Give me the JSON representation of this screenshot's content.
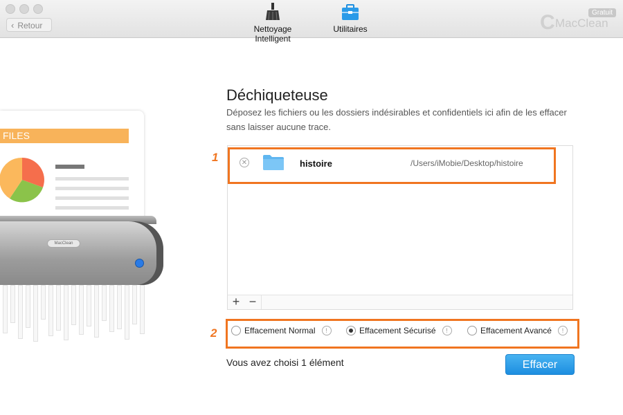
{
  "toolbar": {
    "back_label": "Retour",
    "tabs": [
      {
        "label": "Nettoyage Intelligent",
        "icon": "broom-icon"
      },
      {
        "label": "Utilitaires",
        "icon": "toolbox-icon"
      }
    ],
    "brand_name": "MacClean",
    "brand_badge": "Gratuit"
  },
  "illustration": {
    "banner_text": "FILES",
    "shredder_label": "MacClean"
  },
  "main": {
    "title": "Déchiqueteuse",
    "description": " Déposez les fichiers ou les dossiers indésirables et confidentiels ici afin de les effacer sans laisser aucune trace.",
    "files": [
      {
        "name": "histoire",
        "path": "/Users/iMobie/Desktop/histoire"
      }
    ],
    "add_symbol": "+",
    "remove_symbol": "−",
    "markers": [
      "1",
      "2"
    ],
    "options": [
      {
        "label": "Effacement Normal",
        "selected": false
      },
      {
        "label": "Effacement Sécurisé",
        "selected": true
      },
      {
        "label": "Effacement Avancé",
        "selected": false
      }
    ],
    "info_symbol": "!",
    "status_text": "Vous avez choisi 1  élément",
    "erase_label": "Effacer"
  },
  "colors": {
    "accent_blue": "#1d8ee0",
    "highlight_orange": "#f07520",
    "banner_orange": "#f8b35a"
  }
}
